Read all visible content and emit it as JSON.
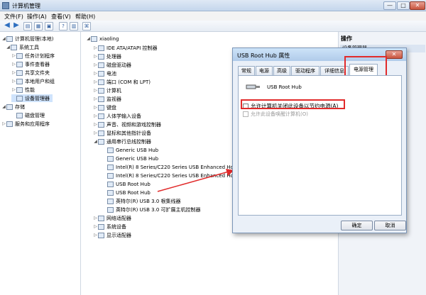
{
  "window": {
    "title": "计算机管理",
    "controls": [
      "—",
      "□",
      "✕"
    ]
  },
  "menu": [
    "文件(F)",
    "操作(A)",
    "查看(V)",
    "帮助(H)"
  ],
  "left_tree": [
    {
      "label": "计算机管理(本地)",
      "level": 0,
      "expanded": true
    },
    {
      "label": "系统工具",
      "level": 1,
      "expanded": true
    },
    {
      "label": "任务计划程序",
      "level": 2
    },
    {
      "label": "事件查看器",
      "level": 2
    },
    {
      "label": "共享文件夹",
      "level": 2
    },
    {
      "label": "本地用户和组",
      "level": 2
    },
    {
      "label": "性能",
      "level": 2
    },
    {
      "label": "设备管理器",
      "level": 2,
      "selected": true
    },
    {
      "label": "存储",
      "level": 1,
      "expanded": true
    },
    {
      "label": "磁盘管理",
      "level": 2
    },
    {
      "label": "服务和应用程序",
      "level": 1
    }
  ],
  "device_tree": [
    {
      "label": "xiaoling",
      "level": 0
    },
    {
      "label": "IDE ATA/ATAPI 控制器",
      "level": 1
    },
    {
      "label": "处理器",
      "level": 1
    },
    {
      "label": "磁盘驱动器",
      "level": 1
    },
    {
      "label": "电池",
      "level": 1
    },
    {
      "label": "端口 (COM 和 LPT)",
      "level": 1
    },
    {
      "label": "计算机",
      "level": 1
    },
    {
      "label": "监视器",
      "level": 1
    },
    {
      "label": "键盘",
      "level": 1
    },
    {
      "label": "人体学输入设备",
      "level": 1
    },
    {
      "label": "声音、视频和游戏控制器",
      "level": 1
    },
    {
      "label": "鼠标和其他指针设备",
      "level": 1
    },
    {
      "label": "通用串行总线控制器",
      "level": 1,
      "expanded": true
    },
    {
      "label": "Generic USB Hub",
      "level": 2
    },
    {
      "label": "Generic USB Hub",
      "level": 2
    },
    {
      "label": "Intel(R) 8 Series/C220 Series USB Enhanced Host Controller #1 - 9C26",
      "level": 2
    },
    {
      "label": "Intel(R) 8 Series/C220 Series USB Enhanced Host Controller #2 - 9C2D",
      "level": 2
    },
    {
      "label": "USB Root Hub",
      "level": 2
    },
    {
      "label": "USB Root Hub",
      "level": 2
    },
    {
      "label": "英特尔(R) USB 3.0 根集线器",
      "level": 2
    },
    {
      "label": "英特尔(R) USB 3.0 可扩展主机控制器",
      "level": 2
    },
    {
      "label": "网络适配器",
      "level": 1
    },
    {
      "label": "系统设备",
      "level": 1
    },
    {
      "label": "显示适配器",
      "level": 1
    }
  ],
  "actions_pane": {
    "header": "操作",
    "item": "设备管理器"
  },
  "dialog": {
    "title": "USB Root Hub 属性",
    "close": "✕",
    "tabs": [
      "常规",
      "电源",
      "高级",
      "驱动程序",
      "详细信息",
      "电源管理"
    ],
    "active_tab": "电源管理",
    "device_name": "USB Root Hub",
    "option_allow_off": "允许计算机关闭此设备以节约电源(A)",
    "option_wake": "允许此设备唤醒计算机(O)",
    "ok": "确定",
    "cancel": "取消"
  },
  "colors": {
    "highlight_red": "#e12b2b",
    "selection_blue": "#cfe3fc"
  }
}
